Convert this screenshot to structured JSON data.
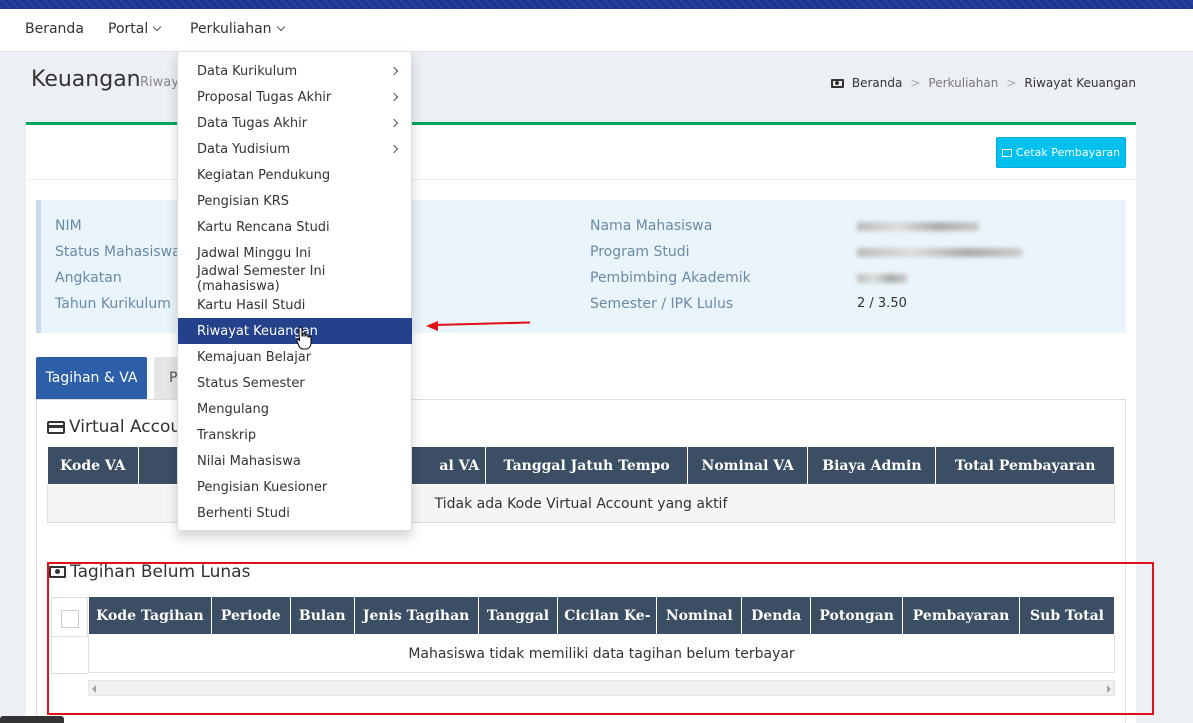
{
  "navbar": {
    "items": [
      {
        "label": "Beranda",
        "dropdown": false
      },
      {
        "label": "Portal",
        "dropdown": true
      },
      {
        "label": "Perkuliahan",
        "dropdown": true
      }
    ]
  },
  "page": {
    "title": "Keuangan",
    "subtitle": "Riway"
  },
  "breadcrumb": [
    "Beranda",
    "Perkuliahan",
    "Riwayat Keuangan"
  ],
  "card": {
    "print_button": "Cetak Pembayaran"
  },
  "student_info": {
    "left_labels": [
      "NIM",
      "Status Mahasiswa",
      "Angkatan",
      "Tahun Kurikulum"
    ],
    "right_labels": [
      "Nama Mahasiswa",
      "Program Studi",
      "Pembimbing Akademik",
      "Semester / IPK Lulus"
    ],
    "semester_ipk": "2 / 3.50"
  },
  "tabs": [
    {
      "label": "Tagihan & VA",
      "active": true
    },
    {
      "label": "P",
      "active": false
    }
  ],
  "virtual_account": {
    "title": "Virtual Accoun",
    "columns": [
      "Kode VA",
      "",
      "al VA",
      "Tanggal Jatuh Tempo",
      "Nominal VA",
      "Biaya Admin",
      "Total Pembayaran"
    ],
    "empty_text": "Tidak ada Kode Virtual Account yang aktif"
  },
  "tagihan": {
    "title": "Tagihan Belum Lunas",
    "columns": [
      "Kode Tagihan",
      "Periode",
      "Bulan",
      "Jenis Tagihan",
      "Tanggal",
      "Cicilan Ke-",
      "Nominal",
      "Denda",
      "Potongan",
      "Pembayaran",
      "Sub Total"
    ],
    "empty_text": "Mahasiswa tidak memiliki data tagihan belum terbayar"
  },
  "dropdown_menu": {
    "items": [
      {
        "label": "Data Kurikulum",
        "submenu": true
      },
      {
        "label": "Proposal Tugas Akhir",
        "submenu": true
      },
      {
        "label": "Data Tugas Akhir",
        "submenu": true
      },
      {
        "label": "Data Yudisium",
        "submenu": true
      },
      {
        "label": "Kegiatan Pendukung",
        "submenu": false
      },
      {
        "label": "Pengisian KRS",
        "submenu": false
      },
      {
        "label": "Kartu Rencana Studi",
        "submenu": false
      },
      {
        "label": "Jadwal Minggu Ini",
        "submenu": false
      },
      {
        "label": "Jadwal Semester Ini (mahasiswa)",
        "submenu": false
      },
      {
        "label": "Kartu Hasil Studi",
        "submenu": false
      },
      {
        "label": "Riwayat Keuangan",
        "submenu": false,
        "active": true
      },
      {
        "label": "Kemajuan Belajar",
        "submenu": false
      },
      {
        "label": "Status Semester",
        "submenu": false
      },
      {
        "label": "Mengulang",
        "submenu": false
      },
      {
        "label": "Transkrip",
        "submenu": false
      },
      {
        "label": "Nilai Mahasiswa",
        "submenu": false
      },
      {
        "label": "Pengisian Kuesioner",
        "submenu": false
      },
      {
        "label": "Berhenti Studi",
        "submenu": false
      }
    ]
  },
  "colors": {
    "primary": "#2c5fa8",
    "menu_active": "#24418b",
    "table_header": "#3c4e63",
    "print_button": "#00c0ef",
    "annotation_red": "#e0101a",
    "card_border": "#00a65a"
  },
  "icons": [
    "caret-down-icon",
    "chevron-right-icon",
    "money-icon",
    "printer-icon",
    "credit-card-icon",
    "hand-cursor-icon"
  ]
}
